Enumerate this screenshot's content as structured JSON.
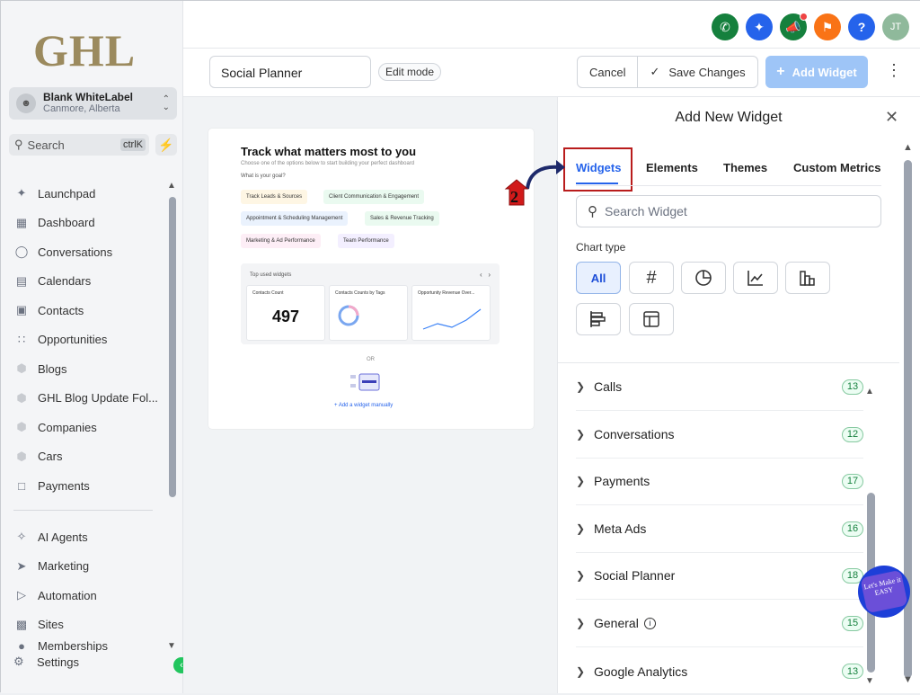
{
  "sidebar": {
    "logo": "GHL",
    "account": {
      "name": "Blank WhiteLabel",
      "location": "Canmore, Alberta"
    },
    "search": {
      "label": "Search",
      "shortcut": "ctrlK"
    },
    "items": [
      {
        "label": "Launchpad",
        "icon": "rocket-icon"
      },
      {
        "label": "Dashboard",
        "icon": "grid-icon"
      },
      {
        "label": "Conversations",
        "icon": "chat-icon"
      },
      {
        "label": "Calendars",
        "icon": "calendar-icon"
      },
      {
        "label": "Contacts",
        "icon": "contacts-icon"
      },
      {
        "label": "Opportunities",
        "icon": "opportunities-icon"
      },
      {
        "label": "Blogs",
        "icon": "cube-icon"
      },
      {
        "label": "GHL Blog Update Fol...",
        "icon": "cube-icon"
      },
      {
        "label": "Companies",
        "icon": "cube-icon"
      },
      {
        "label": "Cars",
        "icon": "cube-icon"
      },
      {
        "label": "Payments",
        "icon": "dollar-icon"
      }
    ],
    "items2": [
      {
        "label": "AI Agents",
        "icon": "sparkle-icon"
      },
      {
        "label": "Marketing",
        "icon": "send-icon"
      },
      {
        "label": "Automation",
        "icon": "play-icon"
      },
      {
        "label": "Sites",
        "icon": "sites-icon"
      },
      {
        "label": "Memberships",
        "icon": "memberships-icon"
      }
    ],
    "settings": "Settings"
  },
  "topbar": {
    "avatar_initials": "JT"
  },
  "toolbar": {
    "dashboard_name": "Social Planner",
    "mode_badge": "Edit mode",
    "cancel": "Cancel",
    "save": "Save Changes",
    "add_widget": "Add Widget"
  },
  "preview": {
    "title": "Track what matters most to you",
    "subtitle": "Choose one of the options below to start building your perfect dashboard",
    "question": "What is your goal?",
    "goals": [
      "Track Leads & Sources",
      "Client Communication & Engagement",
      "Appointment & Scheduling Management",
      "Sales & Revenue Tracking",
      "Marketing & Ad Performance",
      "Team Performance"
    ],
    "top_used": "Top used widgets",
    "mini_widgets": [
      {
        "title": "Contacts Count",
        "value": "497"
      },
      {
        "title": "Contacts Counts by Tags"
      },
      {
        "title": "Opportunity Revenue Over..."
      }
    ],
    "or": "OR",
    "manual": "+ Add a widget manually"
  },
  "panel": {
    "title": "Add New Widget",
    "step_number": "2",
    "tabs": [
      "Widgets",
      "Elements",
      "Themes",
      "Custom Metrics"
    ],
    "search_placeholder": "Search Widget",
    "chart_type_label": "Chart type",
    "chart_types": [
      "All",
      "#",
      "pie",
      "line",
      "bar",
      "hbar",
      "table"
    ],
    "categories": [
      {
        "name": "Calls",
        "count": "13"
      },
      {
        "name": "Conversations",
        "count": "12"
      },
      {
        "name": "Payments",
        "count": "17"
      },
      {
        "name": "Meta Ads",
        "count": "16"
      },
      {
        "name": "Social Planner",
        "count": "18"
      },
      {
        "name": "General",
        "count": "15"
      },
      {
        "name": "Google Analytics",
        "count": "13"
      }
    ]
  },
  "watermark": "Let's Make it EASY",
  "colors": {
    "accent": "#2563eb",
    "highlight": "#b91c1c",
    "success": "#22c55e"
  }
}
